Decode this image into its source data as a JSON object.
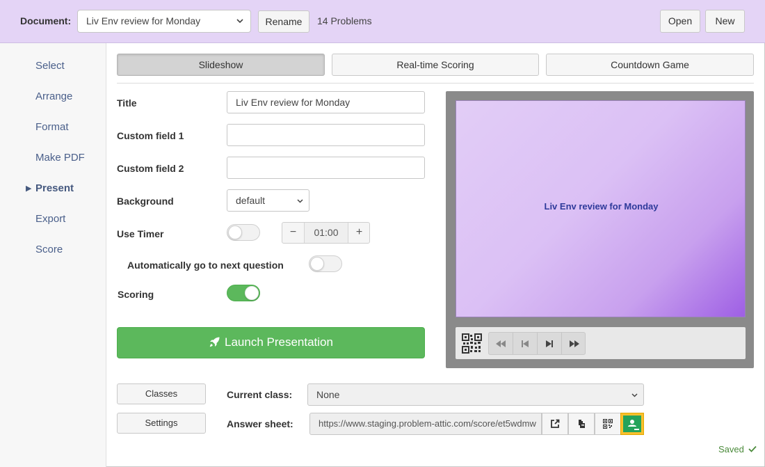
{
  "header": {
    "document_label": "Document:",
    "document_value": "Liv Env review for Monday",
    "rename_label": "Rename",
    "problems_count": "14 Problems",
    "open_label": "Open",
    "new_label": "New"
  },
  "sidebar": {
    "items": [
      {
        "label": "Select"
      },
      {
        "label": "Arrange"
      },
      {
        "label": "Format"
      },
      {
        "label": "Make PDF"
      },
      {
        "label": "Present",
        "active": true
      },
      {
        "label": "Export"
      },
      {
        "label": "Score"
      }
    ]
  },
  "tabs": [
    {
      "label": "Slideshow",
      "active": true
    },
    {
      "label": "Real-time Scoring"
    },
    {
      "label": "Countdown Game"
    }
  ],
  "form": {
    "title_label": "Title",
    "title_value": "Liv Env review for Monday",
    "custom1_label": "Custom field 1",
    "custom1_value": "",
    "custom2_label": "Custom field 2",
    "custom2_value": "",
    "background_label": "Background",
    "background_value": "default",
    "timer_label": "Use Timer",
    "timer_on": false,
    "timer_value": "01:00",
    "timer_minus": "−",
    "timer_plus": "+",
    "auto_next_label": "Automatically go to next question",
    "auto_next_on": false,
    "scoring_label": "Scoring",
    "scoring_on": true,
    "launch_label": "Launch Presentation"
  },
  "preview": {
    "slide_title": "Liv Env review for Monday"
  },
  "bottom": {
    "classes_label": "Classes",
    "settings_label": "Settings",
    "current_class_label": "Current class:",
    "current_class_value": "None",
    "answer_sheet_label": "Answer sheet:",
    "answer_sheet_url": "https://www.staging.problem-attic.com/score/et5wdmw",
    "saved_label": "Saved"
  },
  "colors": {
    "header_bg": "#e4d4f6",
    "accent_green": "#5cb85c",
    "nav_blue": "#4a5f8a",
    "slide_title": "#2e3a9a",
    "classroom_yellow": "#fbc02d",
    "classroom_green": "#25a35a"
  }
}
